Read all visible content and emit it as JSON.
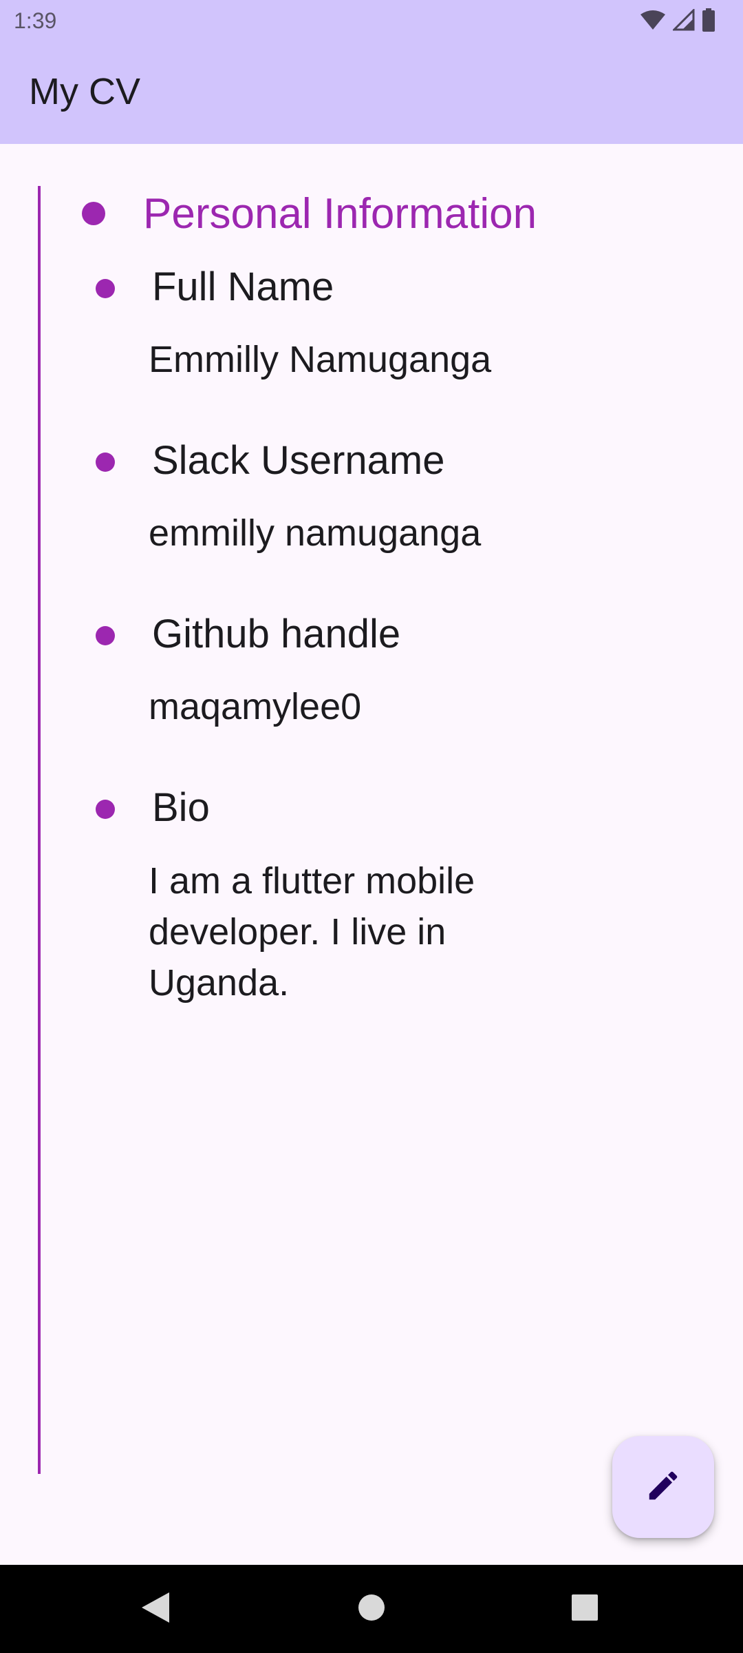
{
  "status_bar": {
    "time": "1:39",
    "icons": [
      "wifi-icon",
      "signal-icon",
      "battery-icon"
    ]
  },
  "app_bar": {
    "title": "My CV"
  },
  "section": {
    "title": "Personal Information",
    "items": [
      {
        "label": "Full Name",
        "value": "Emmilly Namuganga"
      },
      {
        "label": "Slack Username",
        "value": "emmilly namuganga"
      },
      {
        "label": "Github handle",
        "value": "maqamylee0"
      },
      {
        "label": "Bio",
        "value": "I am a flutter mobile developer. I live in Uganda."
      }
    ]
  },
  "fab": {
    "icon": "edit-icon"
  },
  "nav_bar": {
    "icons": [
      "back-icon",
      "home-icon",
      "recents-icon"
    ]
  },
  "colors": {
    "app_bar": "#d1c4fc",
    "accent": "#9c27b0",
    "background": "#fdf7fe",
    "fab": "#eaddff"
  }
}
